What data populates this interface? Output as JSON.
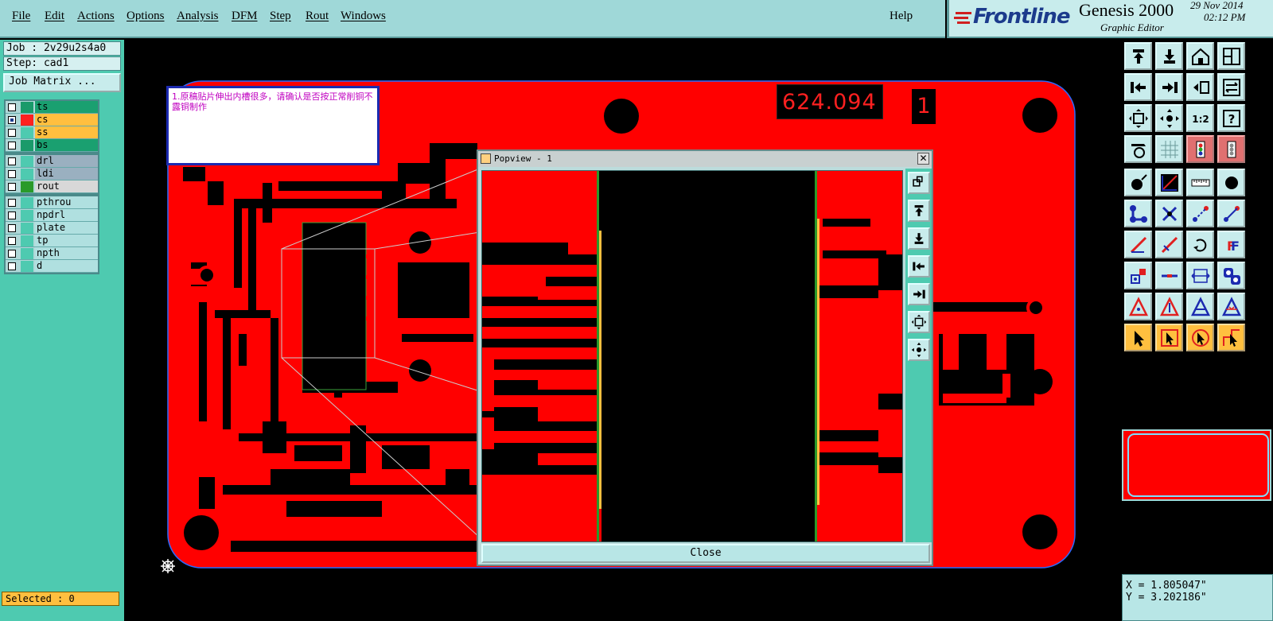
{
  "menu": {
    "items": [
      "File",
      "Edit",
      "Actions",
      "Options",
      "Analysis",
      "DFM",
      "Step",
      "Rout",
      "Windows"
    ],
    "help": "Help"
  },
  "brand": {
    "logo": "Frontline",
    "app": "Genesis 2000",
    "subtitle": "Graphic Editor",
    "date": "29 Nov 2014",
    "time": "02:12 PM",
    "logo_color": "#1c3b8c"
  },
  "job": {
    "job_label": "Job : 2v29u2s4a0",
    "step_label": "Step: cad1",
    "matrix_button": "Job Matrix ..."
  },
  "layers": {
    "group1": [
      {
        "name": "ts",
        "color": "#1aa070",
        "swatch": "#1a9a6a",
        "checked": false
      },
      {
        "name": "cs",
        "color": "#ffbf3f",
        "swatch": "#ff2020",
        "checked": true
      },
      {
        "name": "ss",
        "color": "#ffbf3f",
        "swatch": "#4ecab0",
        "checked": false
      },
      {
        "name": "bs",
        "color": "#1aa070",
        "swatch": "#1a9a6a",
        "checked": false
      }
    ],
    "group2": [
      {
        "name": "drl",
        "color": "#9ab0c0",
        "swatch": "#4ecab0",
        "checked": false
      },
      {
        "name": "ldi",
        "color": "#9ab0c0",
        "swatch": "#4ecab0",
        "checked": false
      },
      {
        "name": "rout",
        "color": "#d8d8d8",
        "swatch": "#2a9a2a",
        "checked": false
      }
    ],
    "group3": [
      {
        "name": "pthrou",
        "color": "#b0e0e0",
        "swatch": "#4ecab0",
        "checked": false
      },
      {
        "name": "npdrl",
        "color": "#b0e0e0",
        "swatch": "#4ecab0",
        "checked": false
      },
      {
        "name": "plate",
        "color": "#b0e0e0",
        "swatch": "#4ecab0",
        "checked": false
      },
      {
        "name": "tp",
        "color": "#b0e0e0",
        "swatch": "#4ecab0",
        "checked": false
      },
      {
        "name": "npth",
        "color": "#b0e0e0",
        "swatch": "#4ecab0",
        "checked": false
      },
      {
        "name": "d",
        "color": "#b0e0e0",
        "swatch": "#4ecab0",
        "checked": false
      }
    ]
  },
  "status": {
    "selected": "Selected : 0",
    "x": "X = 1.805047\"",
    "y": "Y = 3.202186\""
  },
  "canvas": {
    "note": "1.原稿贴片伸出内槽很多，请确认是否按正常削铜不露铜制作",
    "dimension": "624.094",
    "marker": "1",
    "copper_color": "#ff0000"
  },
  "popview": {
    "title": "Popview - 1",
    "close_x": "✕",
    "close_button": "Close",
    "nav_buttons": [
      "fit-icon",
      "pan-up-icon",
      "pan-down-icon",
      "pan-left-icon",
      "pan-right-icon",
      "zoom-out-icon",
      "zoom-in-icon"
    ]
  },
  "toolbar": {
    "rows": [
      [
        "pan-up-icon",
        "pan-down-icon",
        "home-icon",
        "window-icon"
      ],
      [
        "pan-left-icon",
        "pan-right-icon",
        "redraw-icon",
        "snap-icon"
      ],
      [
        "zoom-fit-icon",
        "zoom-center-icon",
        "scale-ratio-icon",
        "help-icon"
      ],
      [
        "measure-icon",
        "grid-icon",
        "layers-on-icon",
        "layers-off-icon"
      ],
      [
        "add-pad-icon",
        "add-line-icon",
        "ruler-icon",
        "round-pad-icon"
      ],
      [
        "connect-icon",
        "delete-node-icon",
        "move-node-icon",
        "add-node-icon"
      ],
      [
        "line-slope-icon",
        "line-cut-icon",
        "rotate-icon",
        "mirror-icon"
      ],
      [
        "pad-select-icon",
        "line-select-icon",
        "dimension-icon",
        "pad-pair-icon"
      ],
      [
        "polygon-a-icon",
        "polygon-b-icon",
        "polygon-c-icon",
        "polygon-d-icon"
      ],
      [
        "select-icon",
        "select-box-icon",
        "select-arc-icon",
        "select-route-icon"
      ]
    ],
    "ratio_label": "1:2",
    "help_label": "?"
  }
}
